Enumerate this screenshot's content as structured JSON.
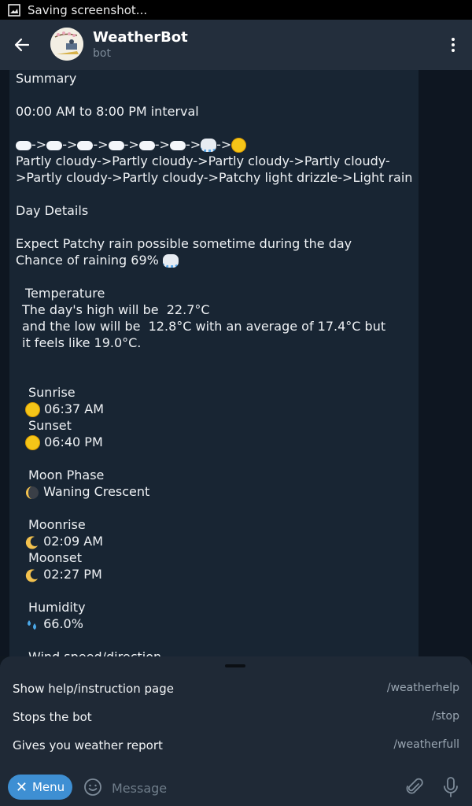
{
  "status_bar": {
    "text": "Saving screenshot..."
  },
  "header": {
    "title": "WeatherBot",
    "subtitle": "bot"
  },
  "message": {
    "summary": "Summary",
    "interval": "00:00 AM to 8:00 PM interval",
    "forecast_line1": "Partly cloudy->Partly cloudy->Partly cloudy->Partly cloudy-",
    "forecast_line2": ">Partly cloudy->Partly cloudy->Patchy light drizzle->Light rain",
    "day_details": "Day Details",
    "expect": "Expect Patchy rain possible sometime during the day",
    "chance": "Chance of raining 69%",
    "temperature_title": "Temperature",
    "temp_line1": "The day's high will be  22.7°C",
    "temp_line2": "and the low will be  12.8°C with an average of 17.4°C but",
    "temp_line3": "it feels like 19.0°C.",
    "sunrise_label": "Sunrise",
    "sunrise_value": "06:37 AM",
    "sunset_label": "Sunset",
    "sunset_value": "06:40 PM",
    "moon_phase_label": "Moon Phase",
    "moon_phase_value": "Waning Crescent",
    "moonrise_label": "Moonrise",
    "moonrise_value": "02:09 AM",
    "moonset_label": "Moonset",
    "moonset_value": "02:27 PM",
    "humidity_label": "Humidity",
    "humidity_value": "66.0%",
    "wind_label": "Wind speed/direction"
  },
  "commands": [
    {
      "description": "Show help/instruction page",
      "command": "/weatherhelp"
    },
    {
      "description": "Stops the bot",
      "command": "/stop"
    },
    {
      "description": "Gives you weather report",
      "command": "/weatherfull"
    }
  ],
  "input_bar": {
    "menu_label": "Menu",
    "placeholder": "Message"
  },
  "colors": {
    "accent": "#3e8fd3",
    "header_bg": "#232e3c",
    "bubble_bg": "#182533",
    "chat_bg": "#0e1621"
  }
}
